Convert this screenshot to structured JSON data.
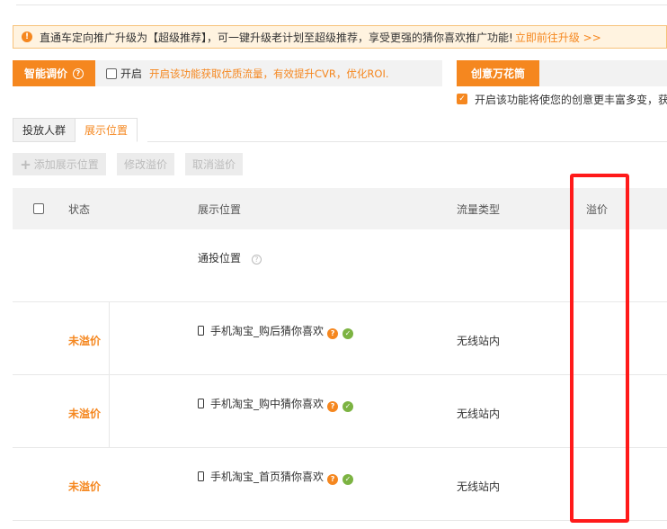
{
  "notice": {
    "icon": "warning-icon",
    "text": "直通车定向推广升级为【超级推荐】，可一键升级老计划至超级推荐，享受更强的猜你喜欢推广功能!",
    "link": "立即前往升级 >>"
  },
  "smart_bid": {
    "button_label": "智能调价",
    "toggle_label": "开启",
    "description": "开启该功能获取优质流量，有效提升CVR，优化ROI."
  },
  "kaleidoscope": {
    "button_label": "创意万花筒",
    "description": "开启该功能将使您的创意更丰富多变，获"
  },
  "tabs": [
    {
      "label": "投放人群",
      "active": false
    },
    {
      "label": "展示位置",
      "active": true
    }
  ],
  "toolbar": {
    "add_label": "添加展示位置",
    "edit_label": "修改溢价",
    "cancel_label": "取消溢价"
  },
  "table": {
    "headers": {
      "status": "状态",
      "position": "展示位置",
      "traffic": "流量类型",
      "premium": "溢价"
    },
    "general_row": {
      "position": "通投位置"
    },
    "rows": [
      {
        "status": "未溢价",
        "position": "手机淘宝_购后猜你喜欢",
        "traffic": "无线站内"
      },
      {
        "status": "未溢价",
        "position": "手机淘宝_购中猜你喜欢",
        "traffic": "无线站内"
      },
      {
        "status": "未溢价",
        "position": "手机淘宝_首页猜你喜欢",
        "traffic": "无线站内"
      }
    ]
  },
  "colors": {
    "accent": "#f5871f",
    "highlight_frame": "#ff1a1a",
    "success": "#7cb342"
  }
}
